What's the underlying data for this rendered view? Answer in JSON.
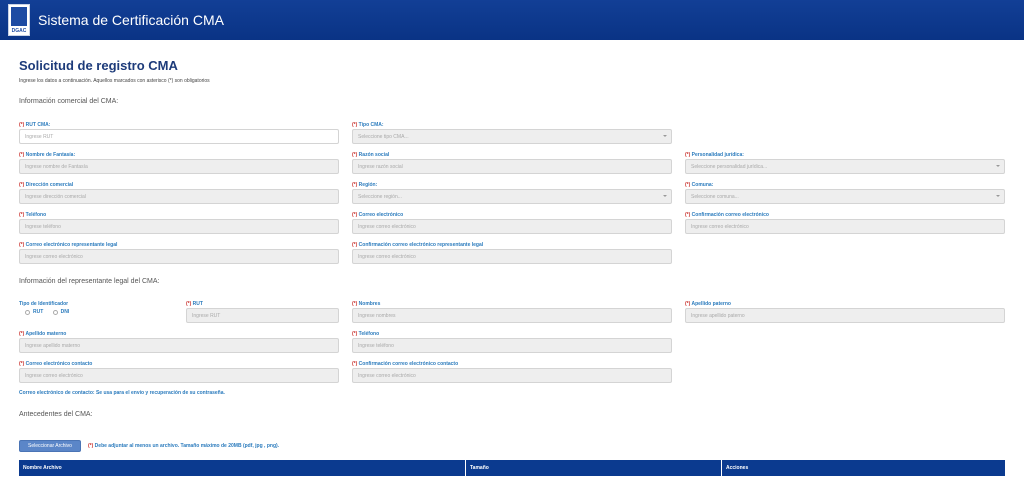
{
  "header": {
    "title": "Sistema de Certificación CMA",
    "logo_text": "DGAC"
  },
  "page": {
    "title": "Solicitud de registro CMA",
    "instructions": "Ingrese los datos a continuación. Aquellos marcados con asterisco (*) son obligatorios"
  },
  "req": "(*)",
  "sections": {
    "comercial": "Información comercial del CMA:",
    "representante": "Información del representante legal del CMA:",
    "antecedentes": "Antecedentes del CMA:"
  },
  "comercial": {
    "rut": {
      "label": "RUT CMA:",
      "placeholder": "Ingrese RUT"
    },
    "tipo": {
      "label": "Tipo CMA:",
      "placeholder": "Seleccione tipo CMA..."
    },
    "fantasia": {
      "label": "Nombre de Fantasía:",
      "placeholder": "Ingrese nombre de Fantasía"
    },
    "razon": {
      "label": "Razón social",
      "placeholder": "Ingrese razón social"
    },
    "personalidad": {
      "label": "Personalidad jurídica:",
      "placeholder": "Seleccione personalidad jurídica..."
    },
    "direccion": {
      "label": "Dirección comercial",
      "placeholder": "Ingrese dirección comercial"
    },
    "region": {
      "label": "Región:",
      "placeholder": "Seleccione región..."
    },
    "comuna": {
      "label": "Comuna:",
      "placeholder": "Seleccione comuna..."
    },
    "telefono": {
      "label": "Teléfono",
      "placeholder": "Ingrese teléfono"
    },
    "correo": {
      "label": "Correo electrónico",
      "placeholder": "Ingrese correo electrónico"
    },
    "conf_correo": {
      "label": "Confirmación correo electrónico",
      "placeholder": "Ingrese correo electrónico"
    },
    "correo_rep": {
      "label": "Correo electrónico representante legal",
      "placeholder": "Ingrese correo electrónico"
    },
    "conf_correo_rep": {
      "label": "Confirmación correo electrónico representante legal",
      "placeholder": "Ingrese correo electrónico"
    }
  },
  "representante": {
    "tipo_id": {
      "label": "Tipo de Identificador",
      "options": [
        "RUT",
        "DNI"
      ]
    },
    "rut": {
      "label": "RUT",
      "placeholder": "Ingrese RUT"
    },
    "nombres": {
      "label": "Nombres",
      "placeholder": "Ingrese nombres"
    },
    "paterno": {
      "label": "Apellido paterno",
      "placeholder": "Ingrese apellido paterno"
    },
    "materno": {
      "label": "Apellido materno",
      "placeholder": "Ingrese apellido materno"
    },
    "telefono": {
      "label": "Teléfono",
      "placeholder": "Ingrese teléfono"
    },
    "correo": {
      "label": "Correo electrónico contacto",
      "placeholder": "Ingrese correo electrónico"
    },
    "conf_correo": {
      "label": "Confirmación correo electrónico contacto",
      "placeholder": "Ingrese correo electrónico"
    },
    "note": "Correo electrónico de contacto: Se usa para el envío y recuperación de su contraseña."
  },
  "antecedentes": {
    "button": "Seleccionar Archivo",
    "note": "Debe adjuntar al menos un archivo. Tamaño máximo de 20MB (pdf, jpg , png).",
    "columns": [
      "Nombre Archivo",
      "Tamaño",
      "Acciones"
    ]
  }
}
